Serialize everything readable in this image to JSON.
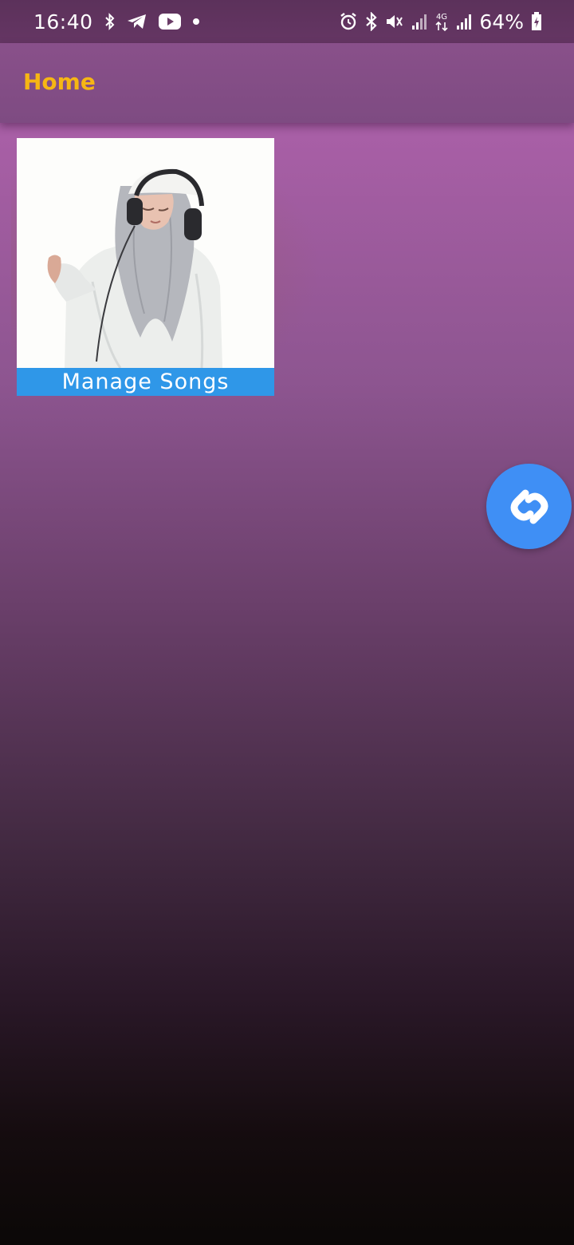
{
  "status_bar": {
    "time": "16:40",
    "battery": "64%",
    "network": "4G",
    "icons_left": [
      "bluetooth-icon",
      "telegram-icon",
      "youtube-icon",
      "dot-icon"
    ],
    "icons_right": [
      "alarm-icon",
      "bluetooth-icon",
      "mute-icon",
      "signal-icon",
      "network-4g-icon",
      "signal-icon",
      "battery-icon"
    ]
  },
  "app_bar": {
    "title": "Home",
    "title_color": "#f6b614"
  },
  "cards": [
    {
      "label": "Manage Songs",
      "image": "artist-photo",
      "label_bg_color": "#2f97e8"
    }
  ],
  "fab": {
    "icon": "shazam-icon",
    "color": "#3f8ff5"
  }
}
